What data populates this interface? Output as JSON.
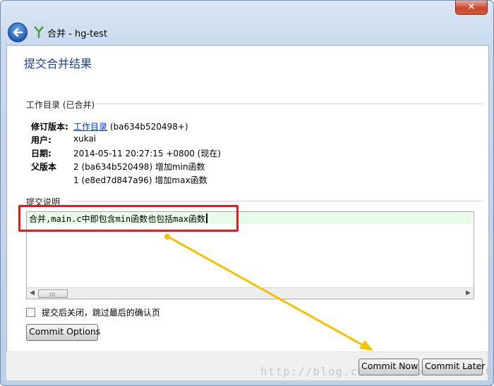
{
  "window": {
    "title": "合并 - hg-test",
    "close_glyph": "✕"
  },
  "page": {
    "title": "提交合并结果"
  },
  "working_dir": {
    "header": "工作目录 (已合并)",
    "revision_label": "修订版本:",
    "revision_link": "工作目录",
    "revision_hash": "(ba634b520498+)",
    "user_label": "用户:",
    "user_value": "xukai",
    "date_label": "日期:",
    "date_value": "2014-05-11 20:27:15 +0800 (现在)",
    "parents_label": "父版本",
    "parents": [
      "2 (ba634b520498) 增加min函数",
      "1 (e8ed7d847a96) 增加max函数"
    ]
  },
  "commit_message": {
    "header": "提交说明",
    "text": "合并,main.c中即包含min函数也包括max函数"
  },
  "options": {
    "close_after_commit_label": "提交后关闭，跳过最后的确认页",
    "close_after_commit_checked": false,
    "commit_options_label": "Commit Options"
  },
  "footer": {
    "commit_now_label": "Commit Now",
    "commit_later_label": "Commit Later",
    "watermark": "http://blog.csdn.net/xukai871105"
  },
  "colors": {
    "title_blue": "#1e3d8f",
    "highlight_red": "#e51a1a",
    "arrow_yellow": "#f5c200",
    "line_green": "#e8fbe8"
  }
}
